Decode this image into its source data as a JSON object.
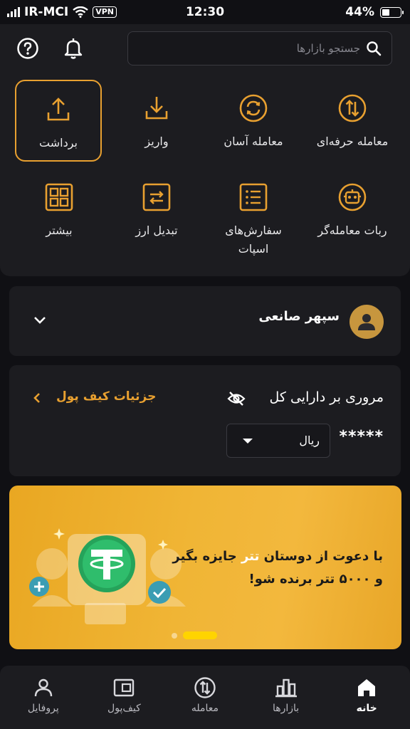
{
  "status_bar": {
    "carrier": "IR-MCI",
    "vpn": "VPN",
    "time": "12:30",
    "battery": "44%",
    "battery_level": 0.44
  },
  "search": {
    "placeholder": "جستجو بازارها"
  },
  "actions": [
    {
      "label": "برداشت",
      "icon": "upload-icon"
    },
    {
      "label": "واریز",
      "icon": "download-icon"
    },
    {
      "label": "معامله آسان",
      "icon": "sync-icon"
    },
    {
      "label": "معامله حرفه‌ای",
      "icon": "swap-icon"
    },
    {
      "label": "بیشتر",
      "icon": "grid-icon"
    },
    {
      "label": "تبدیل ارز",
      "icon": "exchange-icon"
    },
    {
      "label": "سفارش‌های اسپات",
      "line1": "سفارش‌های",
      "line2": "اسپات",
      "icon": "list-icon"
    },
    {
      "label": "ربات معامله‌گر",
      "icon": "robot-icon"
    }
  ],
  "user": {
    "name": "سپهر صانعی"
  },
  "assets": {
    "title": "مروری بر دارایی کل",
    "wallet_link": "جزئیات کیف پول",
    "masked_balance": "*****",
    "currency": "ریال"
  },
  "banner": {
    "line1_pre": "با دعوت از دوستان",
    "line1_hl": "تتر",
    "line1_post": "جایزه بگیر",
    "line2": "و ۵۰۰۰ تتر برنده شو!",
    "slide_count": 2,
    "active_slide": 1
  },
  "tabs": [
    {
      "label": "پروفایل",
      "icon": "user-icon"
    },
    {
      "label": "کیف‌پول",
      "icon": "wallet-icon"
    },
    {
      "label": "معامله",
      "icon": "trade-icon"
    },
    {
      "label": "بازارها",
      "icon": "markets-icon"
    },
    {
      "label": "خانه",
      "icon": "home-icon",
      "active": true
    }
  ],
  "colors": {
    "accent": "#e8a030",
    "background": "#101014",
    "panel": "#1c1c20",
    "banner": "#f0b535"
  }
}
